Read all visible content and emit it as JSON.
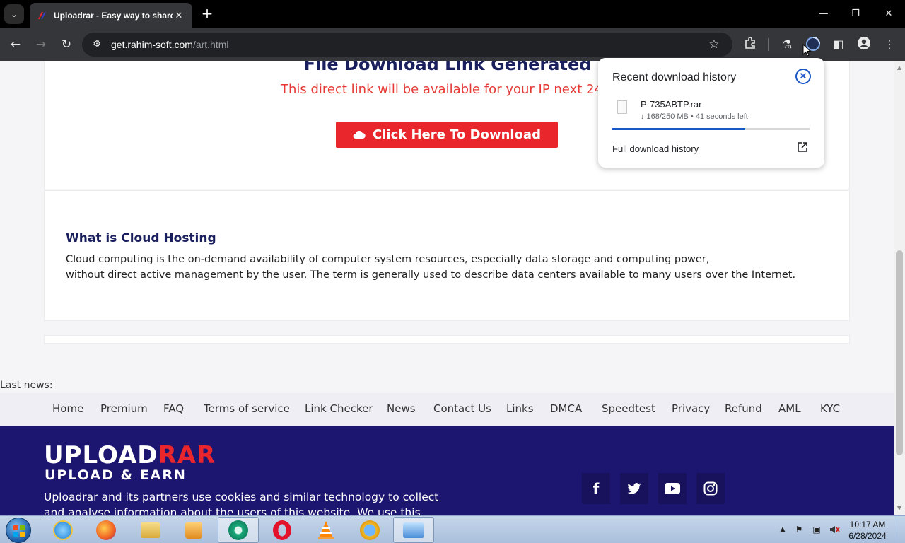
{
  "browser": {
    "tab_title": "Uploadrar - Easy way to share",
    "tab_close": "✕",
    "new_tab": "+",
    "url_host": "get.rahim-soft.com",
    "url_path": "/art.html"
  },
  "page": {
    "download_title": "File Download Link Generated",
    "download_subtitle": "This direct link will be available for your IP next 24 h",
    "download_button": "Click Here To Download",
    "info_heading": "What is Cloud Hosting",
    "info_line1": "Cloud computing is the on-demand availability of computer system resources, especially data storage and computing power,",
    "info_line2": "without direct active management by the user. The term is generally used to describe data centers available to many users over the Internet.",
    "last_news": "Last news:",
    "footer_nav": [
      "Home",
      "Premium",
      "FAQ",
      "Terms of service",
      "Link Checker",
      "News",
      "Contact Us",
      "Links",
      "DMCA",
      "Speedtest",
      "Privacy",
      "Refund",
      "AML",
      "KYC"
    ],
    "logo_upload": "UPLOAD",
    "logo_rar": "RAR",
    "logo_tagline": "UPLOAD & EARN",
    "footer_text": "Uploadrar and its partners use cookies and similar technology to collect and analyse information about the users of this website. We use this information",
    "social": [
      "facebook-icon",
      "twitter-icon",
      "youtube-icon",
      "instagram-icon"
    ]
  },
  "download_popup": {
    "title": "Recent download history",
    "file_name": "P-735ABTP.rar",
    "file_status": "↓ 168/250 MB • 41 seconds left",
    "progress_fraction": 0.672,
    "history_link": "Full download history"
  },
  "taskbar": {
    "time": "10:17 AM",
    "date": "6/28/2024"
  },
  "colors": {
    "accent_red": "#e8262b",
    "navy": "#1a1f5e",
    "footer_bg": "#1d1670",
    "progress_blue": "#1a56c8"
  }
}
